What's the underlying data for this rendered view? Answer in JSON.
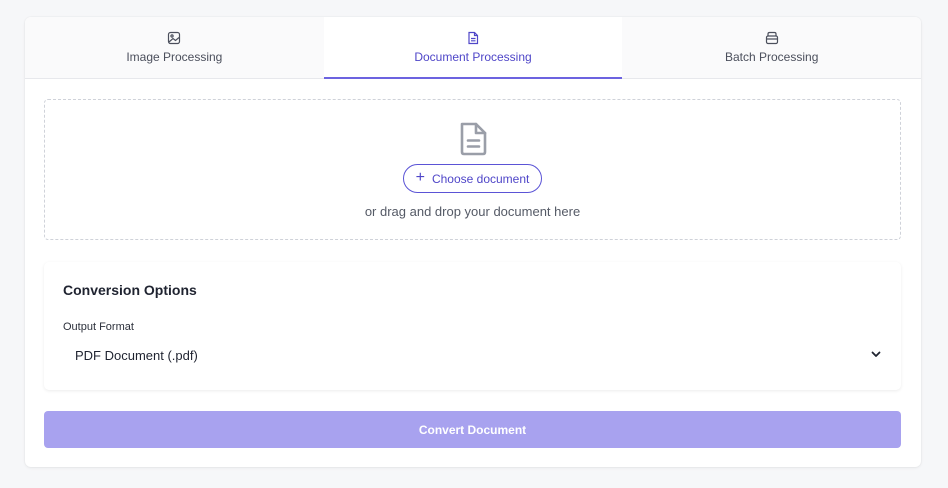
{
  "tabs": [
    {
      "label": "Image Processing",
      "icon": "image-icon"
    },
    {
      "label": "Document Processing",
      "icon": "document-icon"
    },
    {
      "label": "Batch Processing",
      "icon": "archive-icon"
    }
  ],
  "active_tab": "Document Processing",
  "dropzone": {
    "icon": "document-icon",
    "choose_label": "Choose document",
    "hint": "or drag and drop your document here"
  },
  "options": {
    "title": "Conversion Options",
    "output_format_label": "Output Format",
    "output_format_value": "PDF Document (.pdf)"
  },
  "convert_label": "Convert Document",
  "colors": {
    "accent": "#4f46c8",
    "button_disabled": "#a8a2ef"
  }
}
